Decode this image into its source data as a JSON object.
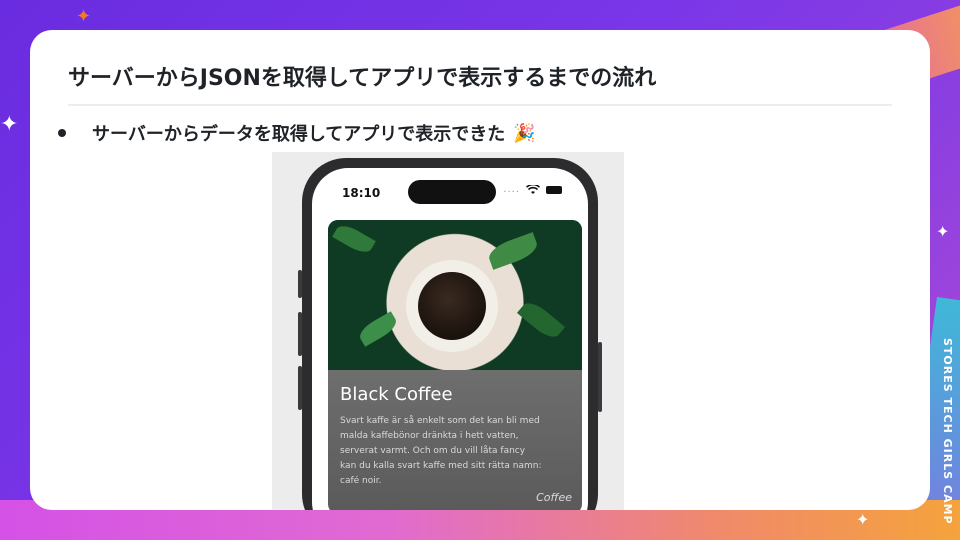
{
  "slide": {
    "title": "サーバーからJSONを取得してアプリで表示するまでの流れ",
    "bullet": "サーバーからデータを取得してアプリで表示できた",
    "bullet_emoji": "🎉",
    "side_text": "STORES TECH GIRLS CAMP"
  },
  "phone": {
    "time": "18:10",
    "status_dots": "....",
    "card": {
      "title": "Black Coffee",
      "description": "Svart kaffe är så enkelt som det kan bli med\nmalda kaffebönor dränkta i hett vatten,\nserverat varmt. Och om du vill låta fancy\nkan du kalla svart kaffe med sitt rätta namn:\ncafé noir.",
      "category": "Coffee"
    }
  },
  "colors": {
    "background": "#6a2ce0",
    "card": "#ffffff",
    "accent_orange": "#f5782a"
  }
}
